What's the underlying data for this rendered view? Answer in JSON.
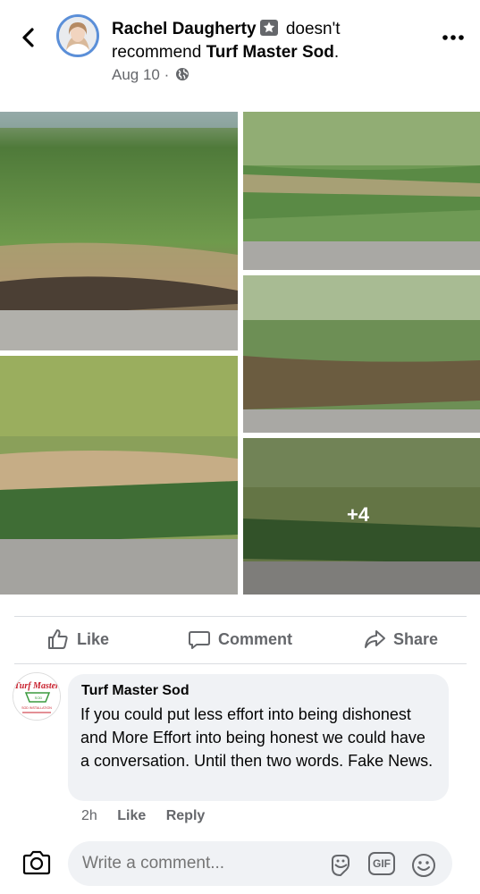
{
  "post": {
    "author": "Rachel Daugherty",
    "verb": "doesn't",
    "verb2": "recommend",
    "page": "Turf Master Sod",
    "period": ".",
    "date": "Aug 10",
    "separator": "·",
    "more_photos": "+4"
  },
  "actions": {
    "like": "Like",
    "comment": "Comment",
    "share": "Share"
  },
  "comment": {
    "author": "Turf Master Sod",
    "text": "If you could put less effort into being dishonest and More Effort into being honest we could have a conversation. Until then two words. Fake News.",
    "time": "2h",
    "like": "Like",
    "reply": "Reply"
  },
  "logo": {
    "line1": "Turf Master",
    "line2": "SOD",
    "line3": "SOD INSTALLATION"
  },
  "composer": {
    "placeholder": "Write a comment...",
    "gif": "GIF"
  },
  "colors": {
    "accent_border": "#5b8fd8",
    "muted": "#65676b",
    "bubble": "#f0f2f5",
    "logo_red": "#c8202d",
    "logo_green": "#3b9a3e"
  },
  "icons": [
    "chevron-left-icon",
    "star-badge-icon",
    "globe-icon",
    "more-horizontal-icon",
    "thumbs-up-icon",
    "comment-icon",
    "share-icon",
    "camera-icon",
    "sticker-icon",
    "gif-icon",
    "emoji-icon"
  ]
}
